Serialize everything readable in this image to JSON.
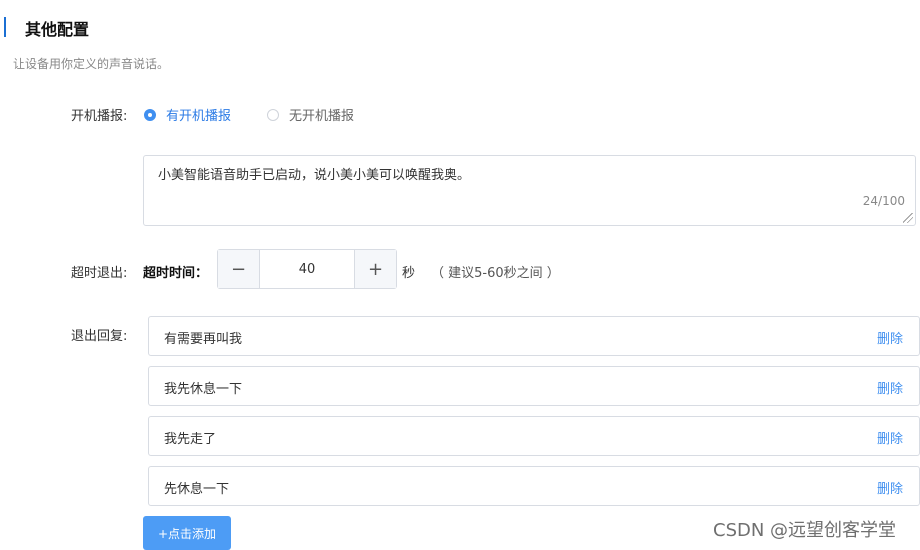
{
  "section": {
    "title": "其他配置",
    "description": "让设备用你定义的声音说话。"
  },
  "boot_broadcast": {
    "label": "开机播报:",
    "options": [
      {
        "label": "有开机播报",
        "selected": true
      },
      {
        "label": "无开机播报",
        "selected": false
      }
    ],
    "message": "小美智能语音助手已启动，说小美小美可以唤醒我奥。",
    "char_count": "24/100"
  },
  "timeout": {
    "label": "超时退出:",
    "field_label": "超时时间：",
    "value": "40",
    "minus_symbol": "−",
    "plus_symbol": "+",
    "unit": "秒",
    "hint": "（ 建议5-60秒之间 ）"
  },
  "exit_reply": {
    "label": "退出回复:",
    "delete_label": "删除",
    "items": [
      {
        "text": "有需要再叫我"
      },
      {
        "text": "我先休息一下"
      },
      {
        "text": "我先走了"
      },
      {
        "text": "先休息一下"
      }
    ],
    "add_button": "+点击添加"
  },
  "watermark": "CSDN @远望创客学堂",
  "colors": {
    "accent": "#3f8ff0",
    "button": "#4d9cf5",
    "section_bar": "#1b6fd3",
    "border": "#d8dce3"
  }
}
